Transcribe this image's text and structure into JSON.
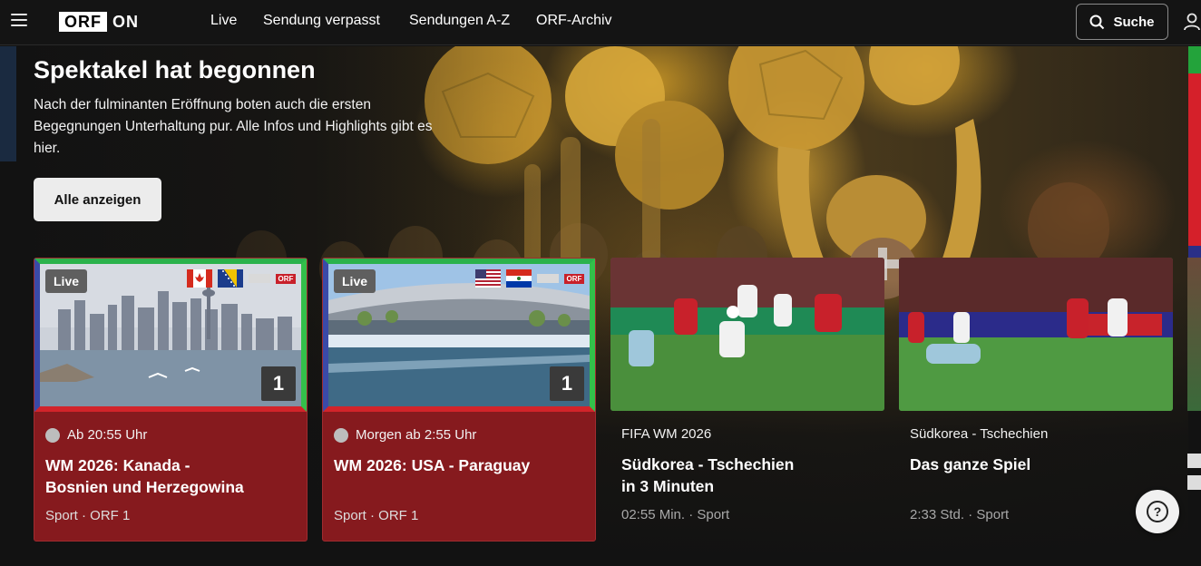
{
  "nav": {
    "logo_box": "ORF",
    "logo_suffix": "ON",
    "links": [
      "Live",
      "Sendung verpasst",
      "Sendungen A-Z",
      "ORF-Archiv"
    ],
    "search_label": "Suche"
  },
  "hero": {
    "title": "Spektakel hat begonnen",
    "description": "Nach der fulminanten Eröffnung boten auch die ersten Begegnungen Unterhaltung pur. Alle Infos und Highlights gibt es hier.",
    "button_label": "Alle anzeigen"
  },
  "cards": [
    {
      "live_badge": "Live",
      "channel_number": "1",
      "time": "Ab 20:55 Uhr",
      "title_line1": "WM 2026: Kanada -",
      "title_line2": "Bosnien und Herzegowina",
      "subtitle": "Sport · ORF 1",
      "orf_tag": "ORF"
    },
    {
      "live_badge": "Live",
      "channel_number": "1",
      "time": "Morgen ab 2:55 Uhr",
      "title_line1": "WM 2026: USA - Paraguay",
      "title_line2": "",
      "subtitle": "Sport · ORF 1",
      "orf_tag": "ORF"
    },
    {
      "category": "FIFA WM 2026",
      "title_line1": "Südkorea - Tschechien",
      "title_line2": "in 3 Minuten",
      "subtitle": "02:55 Min. · Sport"
    },
    {
      "category": "Südkorea - Tschechien",
      "title_line1": "Das ganze Spiel",
      "title_line2": "",
      "subtitle": "2:33 Std. · Sport"
    }
  ],
  "help_label": "?"
}
